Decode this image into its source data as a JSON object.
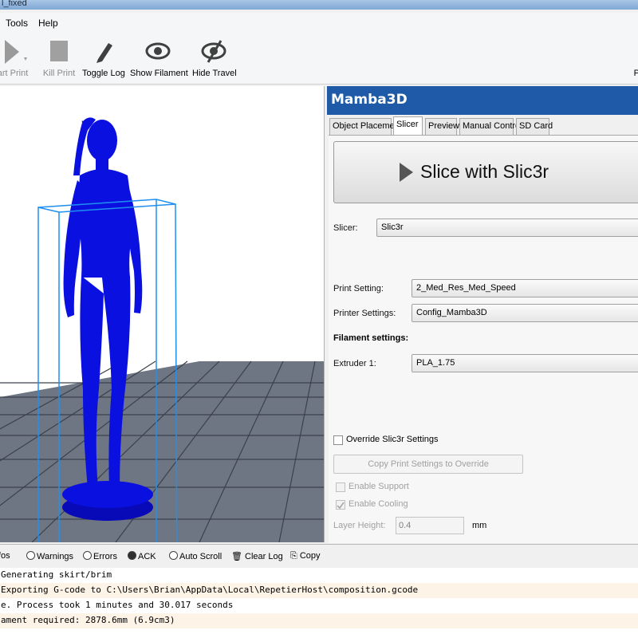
{
  "window": {
    "title": "l_fixed"
  },
  "menu": {
    "items": [
      "Tools",
      "Help"
    ]
  },
  "toolbar": {
    "start_print": "art Print",
    "kill_print": "Kill Print",
    "toggle_log": "Toggle Log",
    "show_filament": "Show Filament",
    "hide_travel": "Hide Travel",
    "right_fragment": "P"
  },
  "printer": {
    "name": "Mamba3D"
  },
  "tabs": [
    {
      "label": "Object Placement",
      "active": false
    },
    {
      "label": "Slicer",
      "active": true
    },
    {
      "label": "Preview",
      "active": false
    },
    {
      "label": "Manual Control",
      "active": false
    },
    {
      "label": "SD Card",
      "active": false
    }
  ],
  "slicer": {
    "slice_button": "Slice with Slic3r",
    "slicer_label": "Slicer:",
    "slicer_value": "Slic3r",
    "print_setting_label": "Print Setting:",
    "print_setting_value": "2_Med_Res_Med_Speed",
    "printer_settings_label": "Printer Settings:",
    "printer_settings_value": "Config_Mamba3D",
    "filament_heading": "Filament settings:",
    "extruder_label": "Extruder 1:",
    "extruder_value": "PLA_1.75",
    "override_label": "Override Slic3r Settings",
    "override_checked": false,
    "copy_button": "Copy Print Settings to Override",
    "enable_support_label": "Enable Support",
    "enable_support_checked": false,
    "enable_cooling_label": "Enable Cooling",
    "enable_cooling_checked": true,
    "layer_height_label": "Layer Height:",
    "layer_height_value": "0.4",
    "layer_height_unit": "mm"
  },
  "log_filters": {
    "infos": "fos",
    "warnings": "Warnings",
    "errors": "Errors",
    "ack": "ACK",
    "auto_scroll": "Auto Scroll",
    "clear_log": "Clear Log",
    "copy": "Copy"
  },
  "log_lines": [
    "Generating skirt/brim",
    "Exporting G-code to C:\\Users\\Brian\\AppData\\Local\\RepetierHost\\composition.gcode",
    "e. Process took 1 minutes and 30.017 seconds",
    "ament required: 2878.6mm (6.9cm3)"
  ],
  "colors": {
    "model": "#0a10e0",
    "bounding_box": "#1f8ff0",
    "grid_floor": "#6e7684",
    "header": "#1e5aa8"
  }
}
